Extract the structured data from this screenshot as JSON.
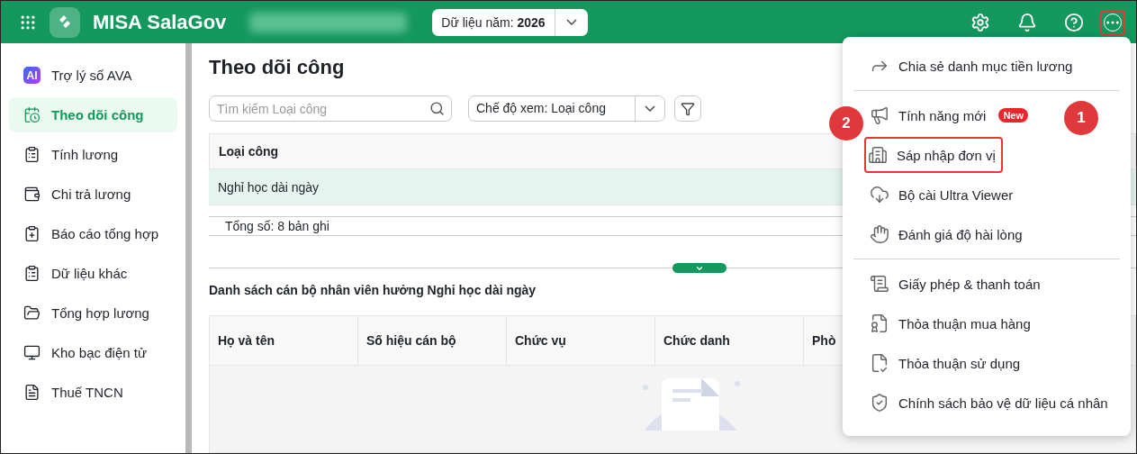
{
  "topbar": {
    "app_name": "MISA SalaGov",
    "year_picker": {
      "label": "Dữ liệu năm:",
      "value": "2026"
    },
    "actions": [
      {
        "kind": "settings",
        "highlighted": false
      },
      {
        "kind": "bell",
        "highlighted": false
      },
      {
        "kind": "help",
        "highlighted": false
      },
      {
        "kind": "more",
        "highlighted": true
      }
    ]
  },
  "sidebar": {
    "items": [
      {
        "label": "Trợ lý số AVA",
        "badge": "AI",
        "selected": false
      },
      {
        "label": "Theo dõi công",
        "selected": true
      },
      {
        "label": "Tính lương",
        "selected": false
      },
      {
        "label": "Chi trả lương",
        "selected": false
      },
      {
        "label": "Báo cáo tổng hợp",
        "selected": false
      },
      {
        "label": "Dữ liệu khác",
        "selected": false
      },
      {
        "label": "Tổng hợp lương",
        "selected": false
      },
      {
        "label": "Kho bạc điện tử",
        "selected": false
      },
      {
        "label": "Thuế TNCN",
        "selected": false
      }
    ]
  },
  "page": {
    "title": "Theo dõi công",
    "search": {
      "placeholder": "Tìm kiếm Loại công"
    },
    "view_mode": {
      "label": "Chế độ xem:",
      "value": "Loại công"
    },
    "table": {
      "columns": [
        "Loại công"
      ],
      "rows": [
        {
          "cells": [
            "Nghỉ học dài ngày"
          ],
          "selected": true
        }
      ],
      "footer": "Tổng số: 8 bản ghi"
    },
    "detail": {
      "title": "Danh sách cán bộ nhân viên hưởng Nghỉ học dài ngày",
      "columns": [
        "Họ và tên",
        "Số hiệu cán bộ",
        "Chức vụ",
        "Chức danh",
        "Phò"
      ]
    }
  },
  "menu": {
    "sections": [
      [
        {
          "label": "Chia sẻ danh mục tiền lương",
          "highlighted": false
        }
      ],
      [
        {
          "label": "Tính năng mới",
          "badge": "New",
          "highlighted": false
        },
        {
          "label": "Sáp nhập đơn vị",
          "highlighted": true
        },
        {
          "label": "Bộ cài Ultra Viewer",
          "highlighted": false
        },
        {
          "label": "Đánh giá độ hài lòng",
          "highlighted": false
        }
      ],
      [
        {
          "label": "Giấy phép & thanh toán",
          "highlighted": false
        },
        {
          "label": "Thỏa thuận mua hàng",
          "highlighted": false
        },
        {
          "label": "Thỏa thuận sử dụng",
          "highlighted": false
        },
        {
          "label": "Chính sách bảo vệ dữ liệu cá nhân",
          "highlighted": false
        }
      ]
    ]
  },
  "annotations": [
    "1",
    "2"
  ]
}
